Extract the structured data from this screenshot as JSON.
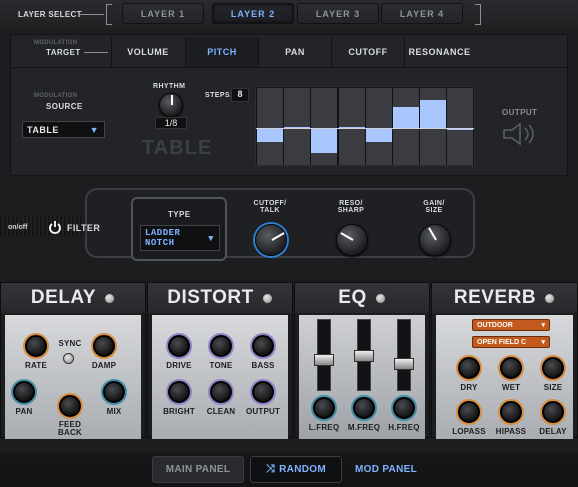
{
  "layer_select": {
    "label": "LAYER SELECT",
    "tabs": [
      "LAYER 1",
      "LAYER 2",
      "LAYER 3",
      "LAYER 4"
    ],
    "active": "LAYER 2"
  },
  "mod_target": {
    "caption": "MODULATION",
    "label": "TARGET",
    "tabs": [
      "VOLUME",
      "PITCH",
      "PAN",
      "CUTOFF",
      "RESONANCE"
    ],
    "active": "PITCH"
  },
  "mod_source": {
    "caption": "MODULATION",
    "label": "SOURCE",
    "value": "TABLE"
  },
  "rhythm": {
    "label": "RHYTHM",
    "value": "1/8"
  },
  "table_label": "TABLE",
  "steps": {
    "label": "STEPS:",
    "value": "8",
    "levels": [
      0.3,
      0.5,
      0.15,
      0.5,
      0.3,
      0.75,
      0.85,
      0.45
    ]
  },
  "output": {
    "label": "OUTPUT"
  },
  "filter": {
    "onoff": "on/off",
    "label": "FILTER",
    "type_label": "TYPE",
    "type_value_line1": "LADDER",
    "type_value_line2": "NOTCH",
    "knobs": [
      {
        "label1": "CUTOFF/",
        "label2": "TALK"
      },
      {
        "label1": "RESO/",
        "label2": "SHARP"
      },
      {
        "label1": "GAIN/",
        "label2": "SIZE"
      }
    ]
  },
  "delay": {
    "title": "DELAY",
    "rate": "RATE",
    "sync": "SYNC",
    "damp": "DAMP",
    "pan": "PAN",
    "feed_back1": "FEED",
    "feed_back2": "BACK",
    "mix": "MIX"
  },
  "distort": {
    "title": "DISTORT",
    "labels": [
      "DRIVE",
      "TONE",
      "BASS",
      "BRIGHT",
      "CLEAN",
      "OUTPUT"
    ]
  },
  "eq": {
    "title": "EQ",
    "labels": [
      "L.FREQ",
      "M.FREQ",
      "H.FREQ"
    ]
  },
  "reverb": {
    "title": "REVERB",
    "type": "OUTDOOR",
    "preset": "OPEN FIELD C",
    "labels": [
      "DRY",
      "WET",
      "SIZE",
      "LOPASS",
      "HIPASS",
      "DELAY"
    ]
  },
  "bottom": {
    "main": "MAIN PANEL",
    "random": "RANDOM",
    "mod": "MOD PANEL"
  },
  "colors": {
    "accent": "#7fb2ff",
    "orange": "#d98c3c",
    "purple": "#8d83c9",
    "teal": "#3f8da8"
  }
}
